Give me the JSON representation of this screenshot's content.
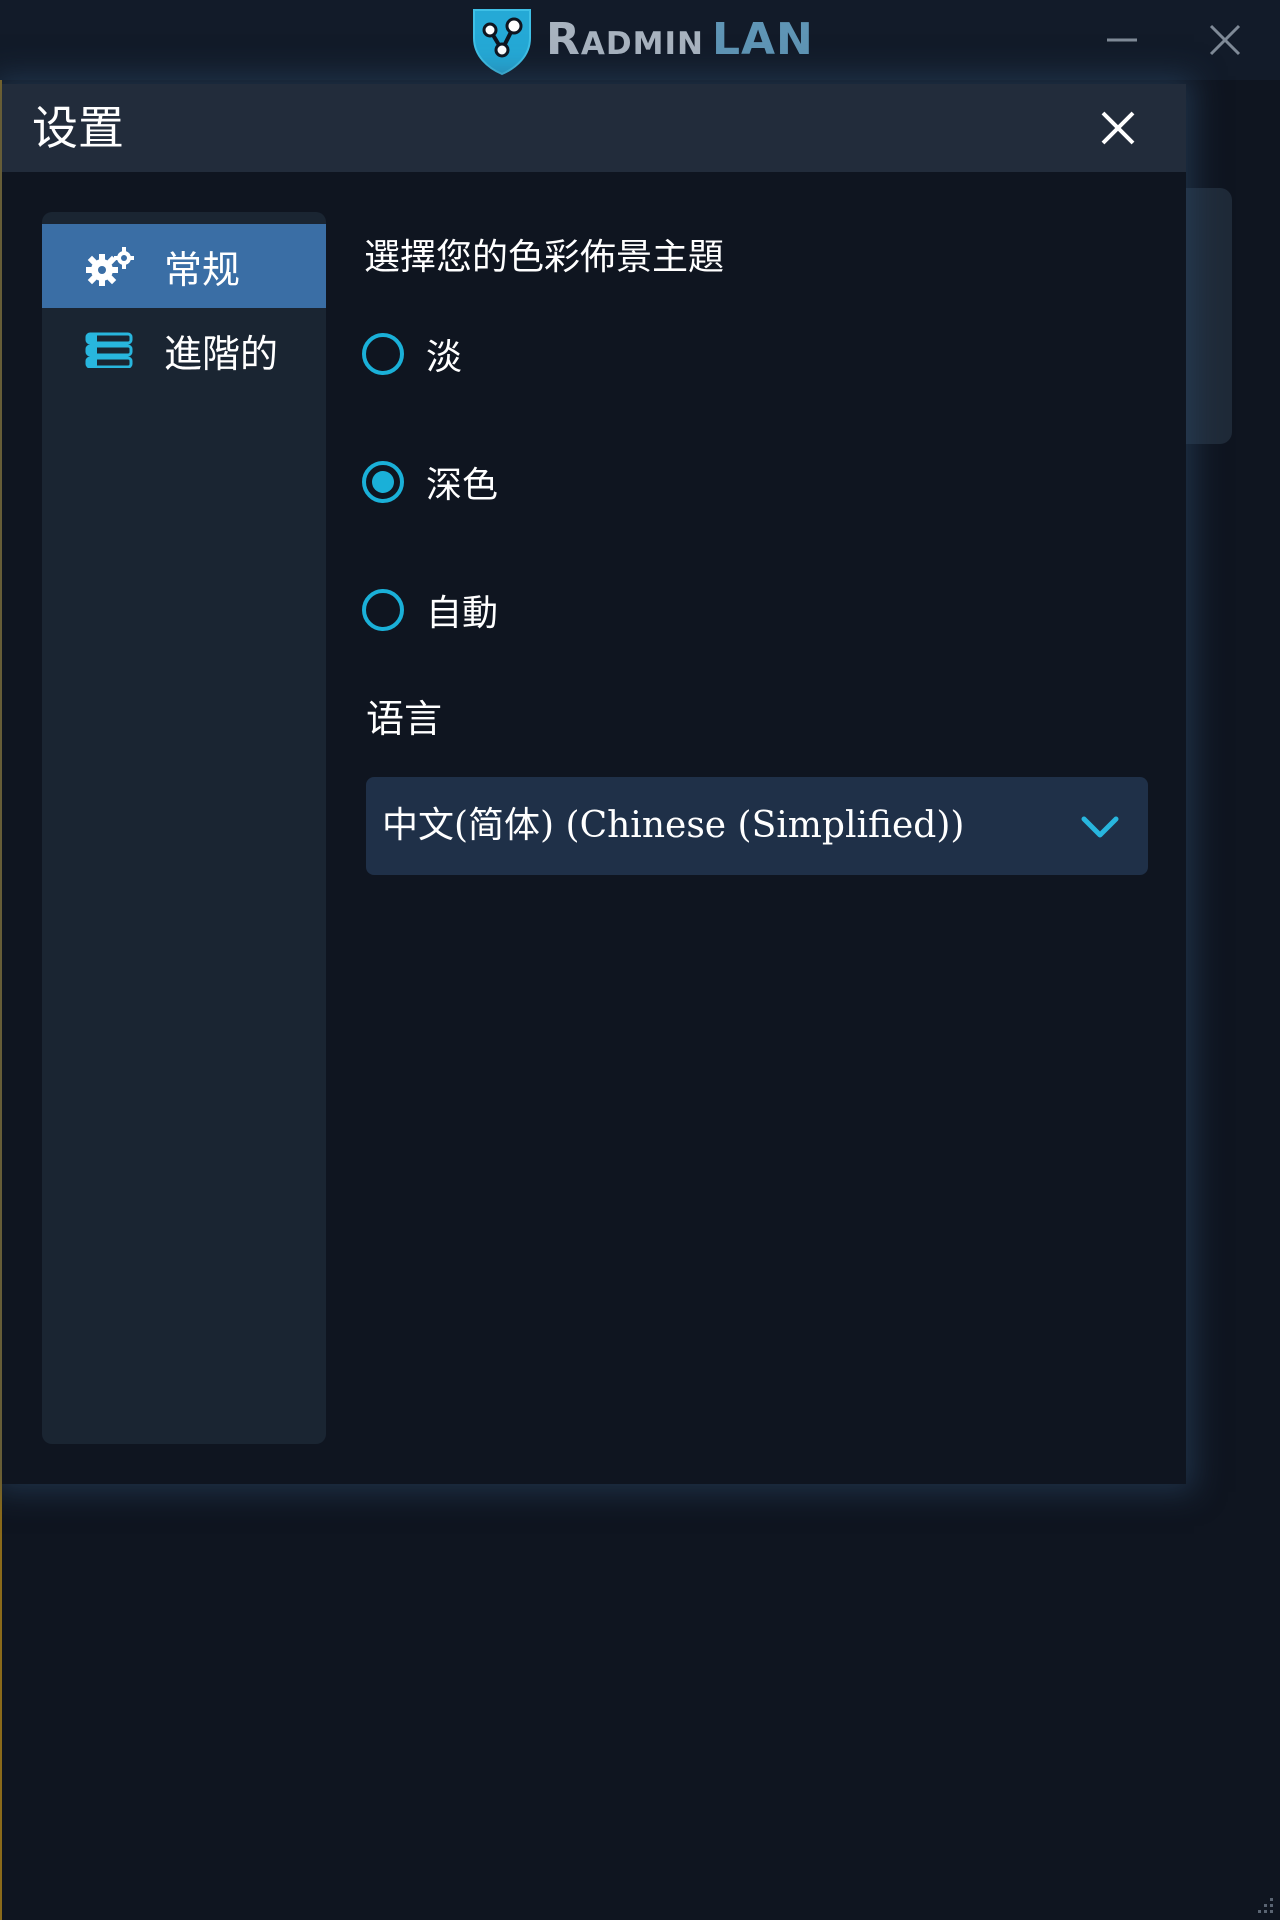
{
  "app": {
    "brand_radmin": "Radmin",
    "brand_lan": "LAN",
    "window_controls": {
      "minimize_icon": "minimize-icon",
      "close_icon": "close-icon"
    }
  },
  "dialog": {
    "title": "设置",
    "close_icon": "close-icon"
  },
  "sidebar": {
    "items": [
      {
        "label": "常规",
        "icon": "gears-icon",
        "active": true
      },
      {
        "label": "進階的",
        "icon": "list-icon",
        "active": false
      }
    ]
  },
  "general": {
    "theme_heading": "選擇您的色彩佈景主題",
    "theme_options": [
      {
        "label": "淡",
        "selected": false
      },
      {
        "label": "深色",
        "selected": true
      },
      {
        "label": "自動",
        "selected": false
      }
    ],
    "language_heading": "语言",
    "language_selected": "中文(简体) (Chinese (Simplified))"
  },
  "colors": {
    "accent": "#1ab0d8",
    "active_nav": "#3a6ea5",
    "background": "#0f1520",
    "header": "#222c3b"
  }
}
